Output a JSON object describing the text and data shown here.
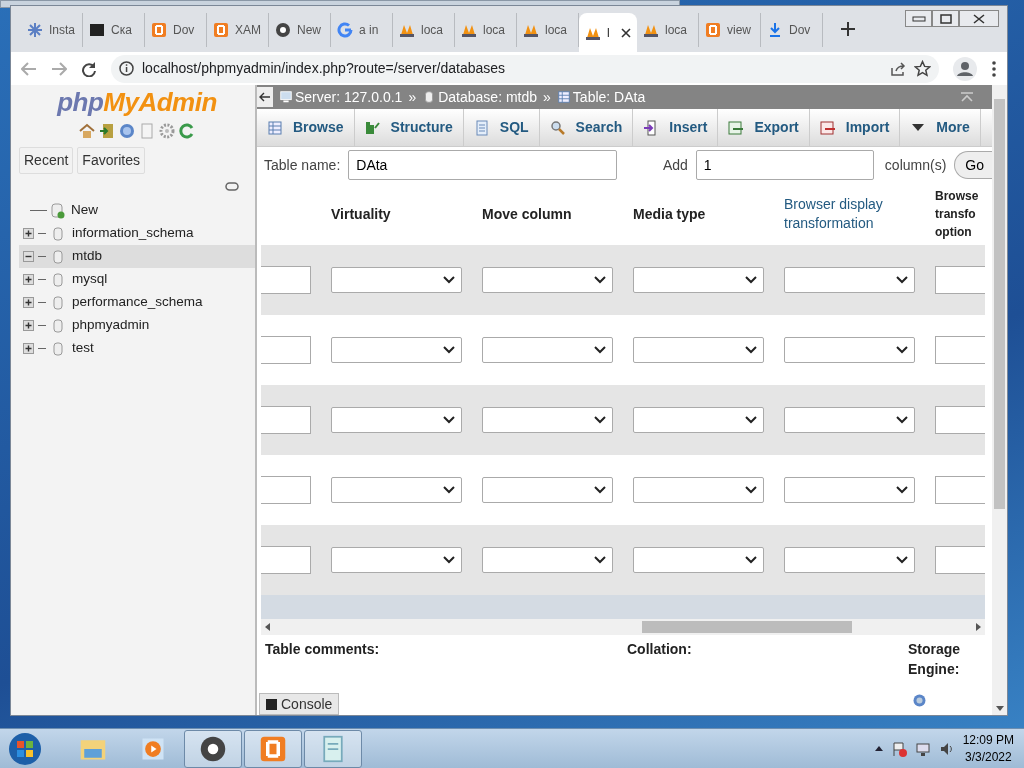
{
  "tabs": [
    {
      "label": "Insta",
      "kind": "snow",
      "selected": false
    },
    {
      "label": "Ска",
      "kind": "terminal",
      "selected": false
    },
    {
      "label": "Dov",
      "kind": "xampp",
      "selected": false
    },
    {
      "label": "XAM",
      "kind": "xampp",
      "selected": false
    },
    {
      "label": "New",
      "kind": "chrome",
      "selected": false
    },
    {
      "label": "a in",
      "kind": "google",
      "selected": false
    },
    {
      "label": "loca",
      "kind": "pma",
      "selected": false
    },
    {
      "label": "loca",
      "kind": "pma",
      "selected": false
    },
    {
      "label": "loca",
      "kind": "pma",
      "selected": false
    },
    {
      "label": "l",
      "kind": "pma",
      "selected": true
    },
    {
      "label": "loca",
      "kind": "pma",
      "selected": false
    },
    {
      "label": "view",
      "kind": "xampp",
      "selected": false
    },
    {
      "label": "Dov",
      "kind": "download",
      "selected": false
    }
  ],
  "address": "localhost/phpmyadmin/index.php?route=/server/databases",
  "sidebar": {
    "logo_php": "php",
    "logo_rest": "MyAdmin",
    "buttons": [
      "Recent",
      "Favorites"
    ],
    "tree": [
      {
        "label": "New",
        "kind": "new"
      },
      {
        "label": "information_schema",
        "kind": "db",
        "expanded": false,
        "selected": false
      },
      {
        "label": "mtdb",
        "kind": "db",
        "expanded": true,
        "selected": true
      },
      {
        "label": "mysql",
        "kind": "db",
        "expanded": false,
        "selected": false
      },
      {
        "label": "performance_schema",
        "kind": "db",
        "expanded": false,
        "selected": false
      },
      {
        "label": "phpmyadmin",
        "kind": "db",
        "expanded": false,
        "selected": false
      },
      {
        "label": "test",
        "kind": "db",
        "expanded": false,
        "selected": false
      }
    ]
  },
  "breadcrumb": [
    {
      "label": "Server: 127.0.0.1",
      "kind": "server"
    },
    {
      "label": "Database: mtdb",
      "kind": "database"
    },
    {
      "label": "Table: DAta",
      "kind": "table"
    }
  ],
  "breadcrumb_sep": "»",
  "menu": [
    {
      "label": "Browse",
      "kind": "table"
    },
    {
      "label": "Structure",
      "kind": "structure"
    },
    {
      "label": "SQL",
      "kind": "sql"
    },
    {
      "label": "Search",
      "kind": "search"
    },
    {
      "label": "Insert",
      "kind": "insert"
    },
    {
      "label": "Export",
      "kind": "export"
    },
    {
      "label": "Import",
      "kind": "import"
    },
    {
      "label": "More",
      "kind": "caret"
    }
  ],
  "table_name": {
    "label": "Table name:",
    "value": "DAta"
  },
  "add": {
    "label": "Add",
    "value": "1",
    "suffix": "column(s)",
    "button": "Go"
  },
  "columns": [
    {
      "label": "Virtuality",
      "link": false
    },
    {
      "label": "Move column",
      "link": false
    },
    {
      "label": "Media type",
      "link": false
    },
    {
      "label": "Browser display transformation",
      "link": true
    },
    {
      "label": "Browse transfo option",
      "link": false
    }
  ],
  "rows": [
    {
      "shaded": true
    },
    {
      "shaded": false
    },
    {
      "shaded": true
    },
    {
      "shaded": false
    },
    {
      "shaded": true
    }
  ],
  "footer": [
    "Table comments:",
    "Collation:",
    "Storage Engine:"
  ],
  "console": "Console",
  "taskbar": {
    "apps": [
      {
        "kind": "folder",
        "active": false
      },
      {
        "kind": "media",
        "active": false
      },
      {
        "kind": "chrome",
        "active": true
      },
      {
        "kind": "xampp",
        "active": true
      },
      {
        "kind": "notepad",
        "active": true
      }
    ],
    "time": "12:09 PM",
    "date": "3/3/2022"
  }
}
